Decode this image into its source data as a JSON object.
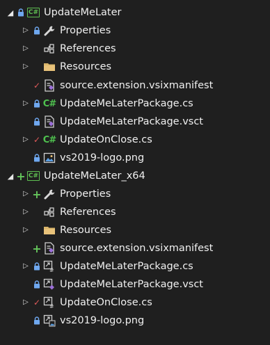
{
  "tree": {
    "projects": [
      {
        "name": "UpdateMeLater",
        "items": [
          {
            "label": "Properties"
          },
          {
            "label": "References"
          },
          {
            "label": "Resources"
          },
          {
            "label": "source.extension.vsixmanifest"
          },
          {
            "label": "UpdateMeLaterPackage.cs"
          },
          {
            "label": "UpdateMeLaterPackage.vsct"
          },
          {
            "label": "UpdateOnClose.cs"
          },
          {
            "label": "vs2019-logo.png"
          }
        ]
      },
      {
        "name": "UpdateMeLater_x64",
        "items": [
          {
            "label": "Properties"
          },
          {
            "label": "References"
          },
          {
            "label": "Resources"
          },
          {
            "label": "source.extension.vsixmanifest"
          },
          {
            "label": "UpdateMeLaterPackage.cs"
          },
          {
            "label": "UpdateMeLaterPackage.vsct"
          },
          {
            "label": "UpdateOnClose.cs"
          },
          {
            "label": "vs2019-logo.png"
          }
        ]
      }
    ]
  },
  "icons": {
    "project": "csharp-project-icon",
    "wrench": "wrench-icon",
    "references": "references-icon",
    "folder": "folder-icon",
    "manifest": "manifest-file-icon",
    "csharp": "csharp-file-icon",
    "linked_csharp": "linked-csharp-file-icon",
    "vsct": "vsct-file-icon",
    "image": "image-file-icon",
    "lock": "lock-icon",
    "checkmark": "pending-edit-icon",
    "plus": "pending-add-icon"
  },
  "colors": {
    "background": "#1f1f1f",
    "text": "#f0f0f0",
    "lock": "#6fa8f0",
    "pending_edit": "#e05a5a",
    "pending_add": "#65c65c",
    "project": "#5fbf52",
    "folder": "#e8c27a"
  }
}
